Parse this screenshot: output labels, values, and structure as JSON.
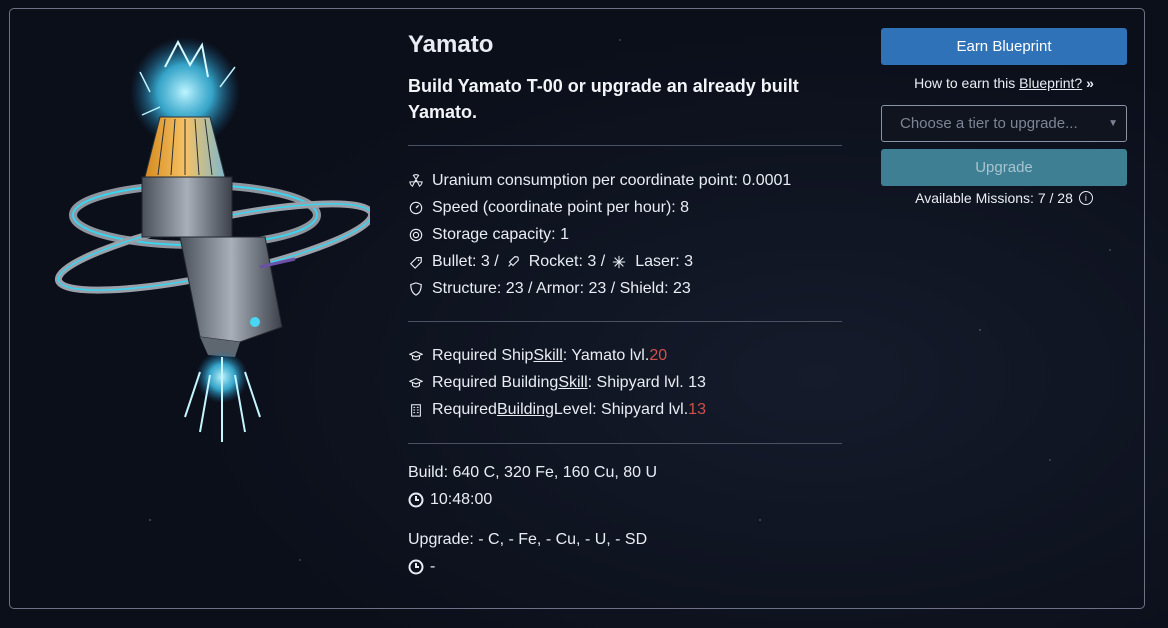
{
  "ship": {
    "name": "Yamato",
    "description": "Build Yamato T-00 or upgrade an already built Yamato."
  },
  "stats": {
    "uranium": "Uranium consumption per coordinate point: 0.0001",
    "speed": "Speed (coordinate point per hour): 8",
    "storage": "Storage capacity: 1",
    "bullet": "Bullet: 3 /",
    "rocket": "Rocket: 3 /",
    "laser": "Laser: 3",
    "defense": "Structure: 23 / Armor: 23 / Shield: 23"
  },
  "requirements": {
    "ship_skill_prefix": "Required Ship ",
    "ship_skill_link": "Skill",
    "ship_skill_suffix": ": Yamato lvl. ",
    "ship_skill_level": "20",
    "building_skill_prefix": "Required Building ",
    "building_skill_link": "Skill",
    "building_skill_suffix": ": Shipyard lvl. 13",
    "building_level_prefix": "Required ",
    "building_level_link": "Building",
    "building_level_suffix": " Level: Shipyard lvl. ",
    "building_level_value": "13"
  },
  "build": {
    "cost": "Build: 640 C, 320 Fe, 160 Cu, 80 U",
    "time": "10:48:00",
    "upgrade_cost": "Upgrade: - C, - Fe, - Cu, - U, - SD",
    "upgrade_time": "-"
  },
  "actions": {
    "earn_blueprint": "Earn Blueprint",
    "howto_prefix": "How to earn this ",
    "howto_link": "Blueprint?",
    "howto_suffix": " »",
    "tier_placeholder": "Choose a tier to upgrade...",
    "upgrade": "Upgrade",
    "missions": "Available Missions: 7 / 28",
    "missions_info": "i"
  },
  "colors": {
    "primary": "#2f72b8",
    "upgrade": "#3f7f93",
    "requirement_unmet": "#d0504a",
    "panel_border": "#6b7384"
  },
  "icons": {
    "uranium": "radiation-icon",
    "speed": "speedometer-icon",
    "storage": "storage-icon",
    "bullet": "bullet-icon",
    "rocket": "rocket-icon",
    "laser": "laser-icon",
    "defense": "shield-icon",
    "skill": "graduation-cap-icon",
    "building": "building-icon",
    "time": "clock-icon"
  }
}
